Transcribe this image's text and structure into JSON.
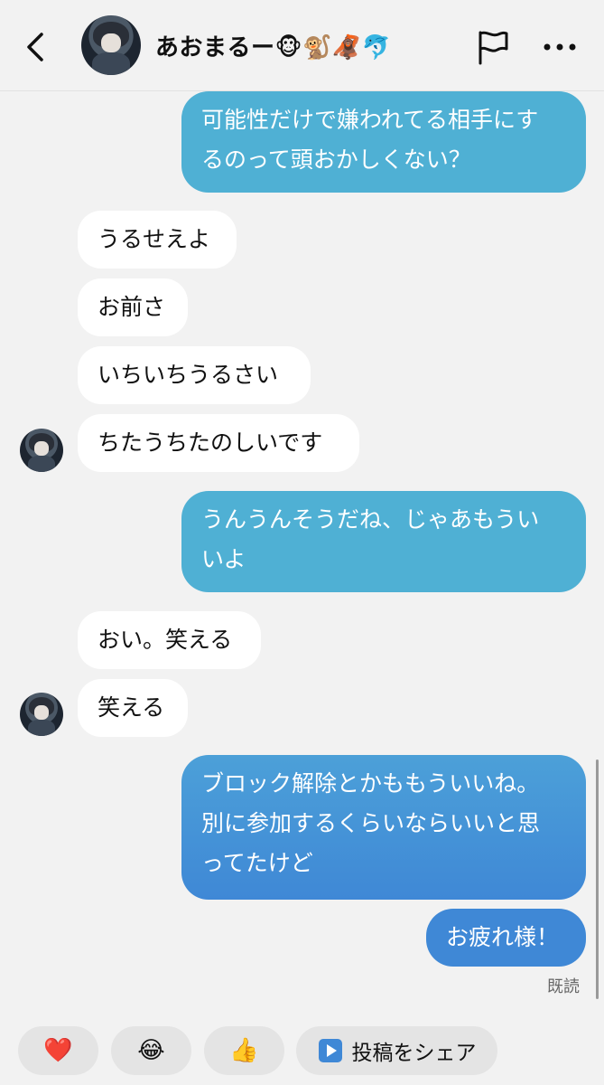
{
  "header": {
    "title": "あおまるー🐵🐒🦧🐬",
    "icons": [
      "back-chevron-icon",
      "flag-icon",
      "more-icon"
    ]
  },
  "messages": [
    {
      "side": "out",
      "lines": [
        "可能性だけで嫌われてる相手にす",
        "るのって頭おかしくない？"
      ]
    },
    {
      "side": "in",
      "text": "うるせえよ"
    },
    {
      "side": "in",
      "text": "お前さ"
    },
    {
      "side": "in",
      "text": "いちいちうるさい"
    },
    {
      "side": "in",
      "text": "ちたうちたのしいです"
    },
    {
      "side": "out",
      "lines": [
        "うんうんそうだね、じゃあもうい",
        "いよ"
      ]
    },
    {
      "side": "in",
      "text": "おい。笑える"
    },
    {
      "side": "in",
      "text": "笑える"
    },
    {
      "side": "out",
      "lines": [
        "ブロック解除とかももういいね。",
        "別に参加するくらいならいいと思",
        "ってたけど"
      ]
    },
    {
      "side": "out",
      "text": "お疲れ様！"
    }
  ],
  "read_status": "既読",
  "reactions": {
    "heart": "❤️",
    "laugh": "😂",
    "thumbs": "👍",
    "share_label": "投稿をシェア"
  },
  "colors": {
    "outgoing_bubble": "#4fb0d4",
    "outgoing_bubble_last": "#3f88d6",
    "incoming_bubble": "#ffffff",
    "background": "#f2f2f2"
  }
}
